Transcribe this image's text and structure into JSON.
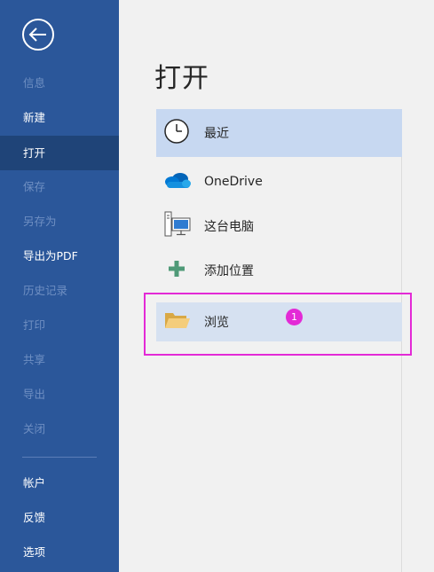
{
  "sidebar": {
    "items": [
      {
        "label": "信息",
        "state": "disabled"
      },
      {
        "label": "新建",
        "state": "normal"
      },
      {
        "label": "打开",
        "state": "active"
      },
      {
        "label": "保存",
        "state": "disabled"
      },
      {
        "label": "另存为",
        "state": "disabled"
      },
      {
        "label": "导出为PDF",
        "state": "normal"
      },
      {
        "label": "历史记录",
        "state": "disabled"
      },
      {
        "label": "打印",
        "state": "disabled"
      },
      {
        "label": "共享",
        "state": "disabled"
      },
      {
        "label": "导出",
        "state": "disabled"
      },
      {
        "label": "关闭",
        "state": "disabled"
      }
    ],
    "bottom_items": [
      {
        "label": "帐户"
      },
      {
        "label": "反馈"
      },
      {
        "label": "选项"
      }
    ]
  },
  "main": {
    "title": "打开",
    "locations": [
      {
        "label": "最近",
        "icon": "clock-icon",
        "state": "selected"
      },
      {
        "label": "OneDrive",
        "icon": "cloud-icon",
        "state": "normal"
      },
      {
        "label": "这台电脑",
        "icon": "computer-icon",
        "state": "normal"
      },
      {
        "label": "添加位置",
        "icon": "plus-icon",
        "state": "normal"
      },
      {
        "label": "浏览",
        "icon": "folder-icon",
        "state": "hover"
      }
    ]
  },
  "annotation": {
    "step_number": "1",
    "color": "#e32ad6"
  },
  "colors": {
    "sidebar_bg": "#2b579a",
    "sidebar_active": "#1f4478",
    "main_bg": "#f1f1f1",
    "selected_bg": "#c7d8f1"
  }
}
